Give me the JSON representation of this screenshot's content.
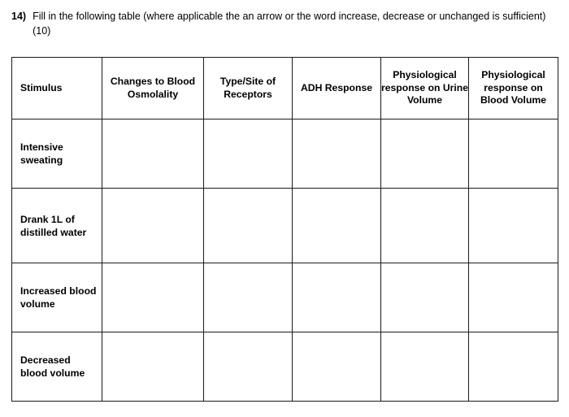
{
  "question": {
    "number": "14)",
    "text": "Fill in the following table (where applicable the an arrow or the word increase, decrease or unchanged is sufficient) (10)"
  },
  "table": {
    "headers": [
      "Stimulus",
      "Changes to Blood Osmolality",
      "Type/Site of Receptors",
      "ADH Response",
      "Physiological response on Urine Volume",
      "Physiological response on Blood Volume"
    ],
    "rows": [
      {
        "stimulus": "Intensive sweating",
        "osmolality": "",
        "receptors": "",
        "adh": "",
        "urine_volume": "",
        "blood_volume": ""
      },
      {
        "stimulus": "Drank 1L of distilled water",
        "osmolality": "",
        "receptors": "",
        "adh": "",
        "urine_volume": "",
        "blood_volume": ""
      },
      {
        "stimulus": "Increased blood volume",
        "osmolality": "",
        "receptors": "",
        "adh": "",
        "urine_volume": "",
        "blood_volume": ""
      },
      {
        "stimulus": "Decreased blood volume",
        "osmolality": "",
        "receptors": "",
        "adh": "",
        "urine_volume": "",
        "blood_volume": ""
      }
    ]
  },
  "colors": {
    "border": "#1a1a1a",
    "text": "#000000",
    "background": "#ffffff"
  }
}
